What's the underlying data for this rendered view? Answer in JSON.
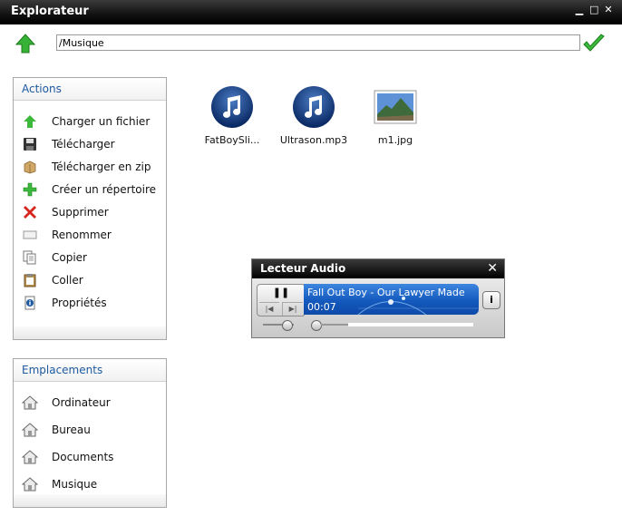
{
  "window": {
    "title": "Explorateur",
    "minimize_label": "▁",
    "maximize_label": "□",
    "close_label": "✕"
  },
  "pathbar": {
    "path": "/Musique"
  },
  "actions": {
    "title": "Actions",
    "items": [
      {
        "label": "Charger un fichier",
        "icon": "upload-arrow-icon"
      },
      {
        "label": "Télécharger",
        "icon": "floppy-disk-icon"
      },
      {
        "label": "Télécharger en zip",
        "icon": "zip-box-icon"
      },
      {
        "label": "Créer un répertoire",
        "icon": "plus-icon"
      },
      {
        "label": "Supprimer",
        "icon": "red-x-icon"
      },
      {
        "label": "Renommer",
        "icon": "rename-field-icon"
      },
      {
        "label": "Copier",
        "icon": "copy-pages-icon"
      },
      {
        "label": "Coller",
        "icon": "clipboard-icon"
      },
      {
        "label": "Propriétés",
        "icon": "info-icon"
      }
    ]
  },
  "locations": {
    "title": "Emplacements",
    "items": [
      {
        "label": "Ordinateur",
        "icon": "home-icon"
      },
      {
        "label": "Bureau",
        "icon": "home-icon"
      },
      {
        "label": "Documents",
        "icon": "home-icon"
      },
      {
        "label": "Musique",
        "icon": "home-icon"
      }
    ]
  },
  "files": [
    {
      "name": "FatBoySli...",
      "icon": "music-note-icon"
    },
    {
      "name": "Ultrason.mp3",
      "icon": "music-note-icon"
    },
    {
      "name": "m1.jpg",
      "icon": "image-thumbnail-icon"
    }
  ],
  "player": {
    "title": "Lecteur Audio",
    "track": "Fall Out Boy - Our Lawyer Made",
    "time": "00:07",
    "pause_symbol": "❚❚",
    "prev_symbol": "|◀",
    "next_symbol": "▶|",
    "info_symbol": "i",
    "close_symbol": "✕"
  },
  "colors": {
    "accent": "#1e5aa0",
    "player_display": "#1459bd",
    "titlebar": "#000000"
  }
}
